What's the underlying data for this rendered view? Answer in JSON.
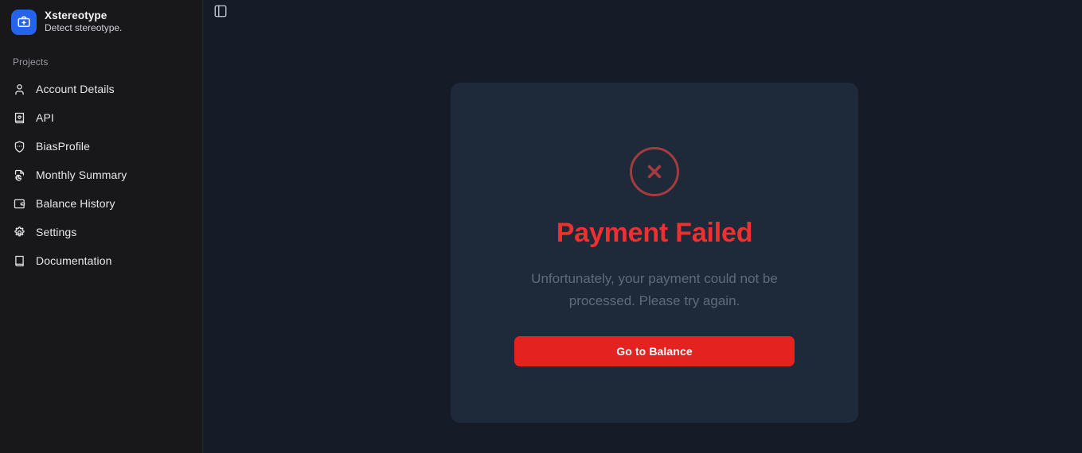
{
  "brand": {
    "icon": "briefcase-medical-icon",
    "title": "Xstereotype",
    "subtitle": "Detect stereotype.",
    "logo_color": "#2563eb"
  },
  "sidebar": {
    "section_label": "Projects",
    "items": [
      {
        "label": "Account Details",
        "icon": "user-icon"
      },
      {
        "label": "API",
        "icon": "book-heart-icon"
      },
      {
        "label": "BiasProfile",
        "icon": "shield-ellipsis-icon"
      },
      {
        "label": "Monthly Summary",
        "icon": "file-pie-chart-icon"
      },
      {
        "label": "Balance History",
        "icon": "wallet-icon"
      },
      {
        "label": "Settings",
        "icon": "gear-icon"
      },
      {
        "label": "Documentation",
        "icon": "book-icon"
      }
    ]
  },
  "main": {
    "panel_toggle_icon": "panel-left-icon",
    "card": {
      "status_icon": "circle-x-icon",
      "title": "Payment Failed",
      "description": "Unfortunately, your payment could not be processed. Please try again.",
      "cta_label": "Go to Balance",
      "title_color": "#ef3030",
      "cta_color": "#e42320",
      "status_icon_color": "#a23c3f",
      "card_background": "#1e2939"
    }
  }
}
